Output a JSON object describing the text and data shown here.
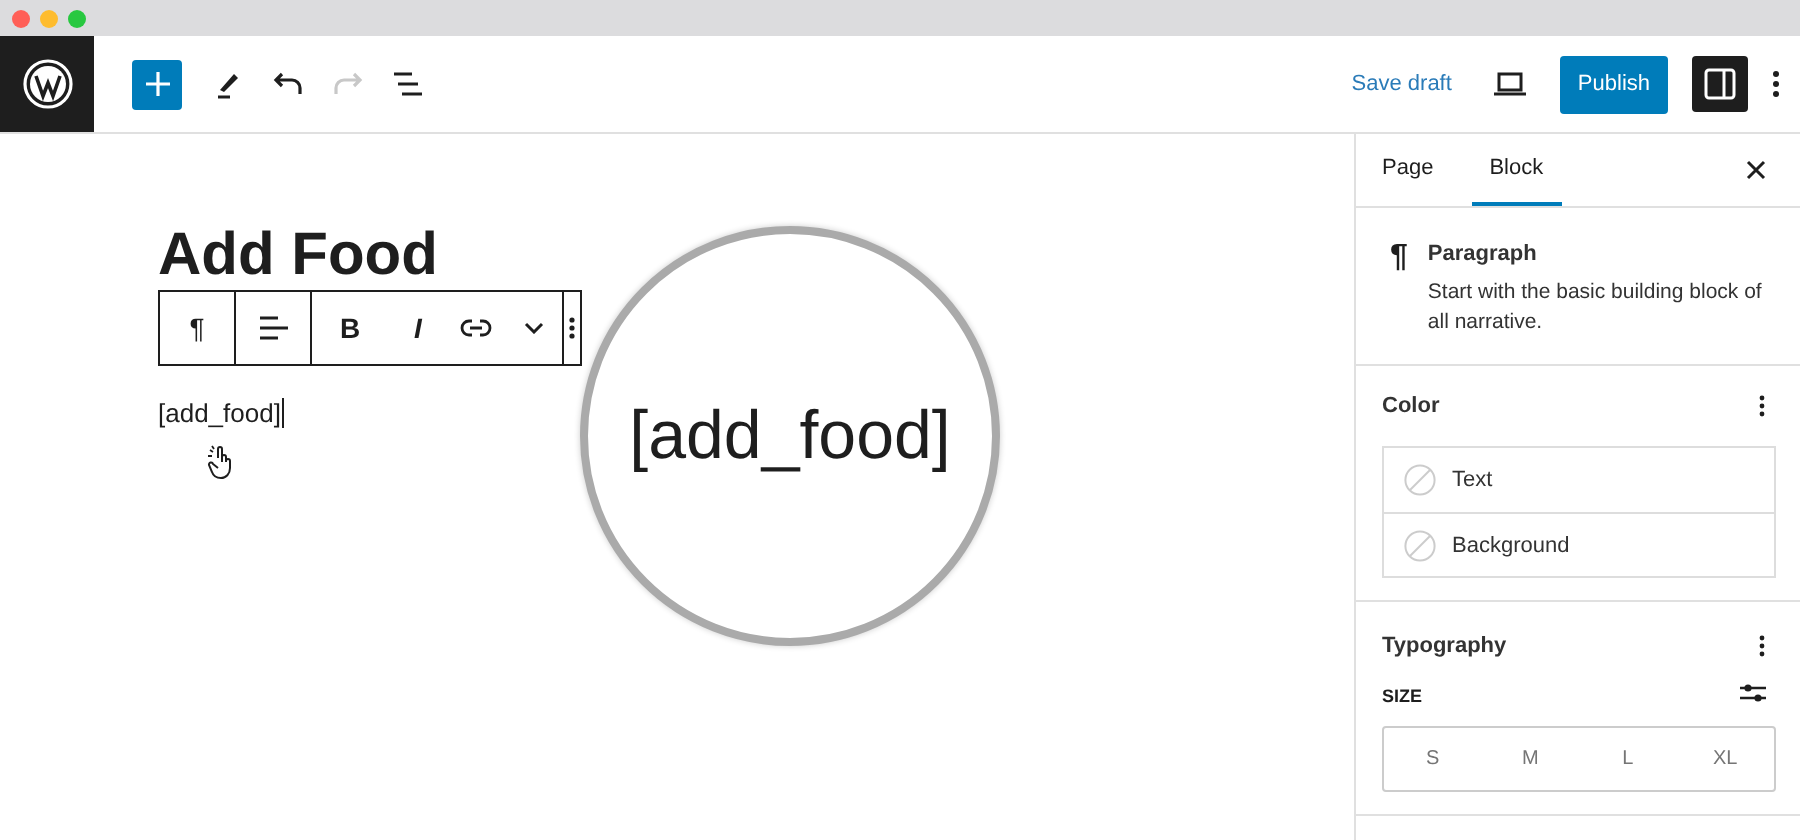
{
  "window_controls": [
    {
      "color": "#ff5f57"
    },
    {
      "color": "#febc2e"
    },
    {
      "color": "#28c840"
    }
  ],
  "header": {
    "tools": [
      {
        "kind": "add"
      },
      {
        "kind": "edit"
      },
      {
        "kind": "undo",
        "disabled": false
      },
      {
        "kind": "redo",
        "disabled": true
      },
      {
        "kind": "outline"
      }
    ],
    "save_draft": "Save draft",
    "publish": "Publish",
    "settings_pressed": true
  },
  "editor": {
    "title": "Add Food",
    "paragraph": "[add_food]",
    "block_toolbar": [
      {
        "kind": "paragraph",
        "label": "¶"
      },
      {
        "kind": "align"
      },
      {
        "kind": "bold",
        "label": "B"
      },
      {
        "kind": "italic",
        "label": "I"
      },
      {
        "kind": "link"
      },
      {
        "kind": "more"
      },
      {
        "kind": "options"
      }
    ],
    "magnifier": "[add_food]"
  },
  "sidebar": {
    "tabs": [
      {
        "label": "Page",
        "selected": false
      },
      {
        "label": "Block",
        "selected": true
      }
    ],
    "block": {
      "icon": "¶",
      "name": "Paragraph",
      "description": "Start with the basic building block of all narrative."
    },
    "color": {
      "title": "Color",
      "items": [
        {
          "label": "Text"
        },
        {
          "label": "Background"
        }
      ]
    },
    "typography": {
      "title": "Typography",
      "size_label": "SIZE",
      "sizes": [
        {
          "label": "S",
          "selected": false
        },
        {
          "label": "M",
          "selected": false
        },
        {
          "label": "L",
          "selected": false
        },
        {
          "label": "XL",
          "selected": false
        }
      ]
    }
  }
}
